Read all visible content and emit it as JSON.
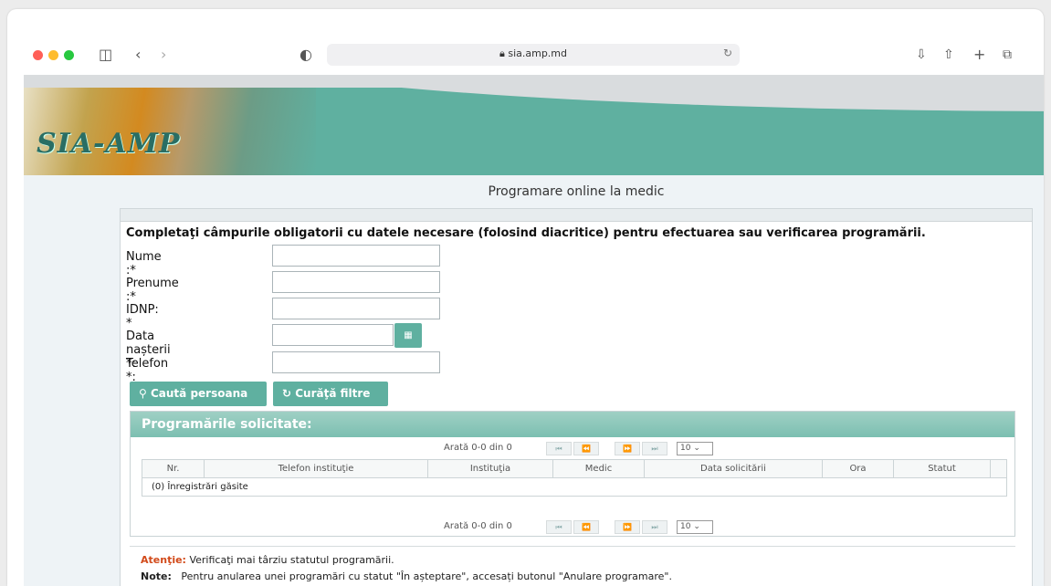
{
  "browser": {
    "url": "sia.amp.md",
    "traffic_lights": [
      "#ff5f57",
      "#febc2e",
      "#28c840"
    ]
  },
  "header": {
    "logo_text": "SIA-AMP",
    "page_title": "Programare online la medic"
  },
  "form": {
    "instruction": "Completaţi câmpurile obligatorii cu datele necesare (folosind diacritice) pentru efectuarea sau verificarea programării.",
    "fields": [
      {
        "label": "Nume :*",
        "value": ""
      },
      {
        "label": "Prenume :*",
        "value": ""
      },
      {
        "label": "IDNP: *",
        "value": ""
      },
      {
        "label": "Data nașterii *:",
        "value": ""
      },
      {
        "label": "Telefon *:",
        "value": ""
      }
    ],
    "search_button": "Caută persoana",
    "clear_button": "Curăţă filtre"
  },
  "grid": {
    "title": "Programările solicitate:",
    "pager_text": "Arată 0-0 din 0",
    "page_size": "10",
    "columns": [
      "Nr.",
      "Telefon instituţie",
      "Instituţia",
      "Medic",
      "Data solicitării",
      "Ora",
      "Statut"
    ],
    "empty_message": "(0) Înregistrări găsite"
  },
  "notes": {
    "attention_label": "Atenţie:",
    "attention_text": "Verificaţi mai târziu statutul programării.",
    "note_label": "Note:",
    "note_text": "Pentru anularea unei programări cu statut \"În așteptare\", accesați butonul \"Anulare programare\"."
  }
}
